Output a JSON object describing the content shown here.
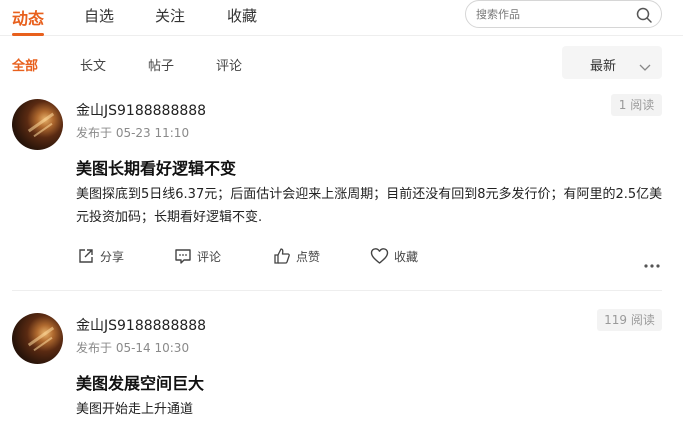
{
  "nav": {
    "tabs": [
      {
        "label": "动态",
        "active": true
      },
      {
        "label": "自选",
        "active": false
      },
      {
        "label": "关注",
        "active": false
      },
      {
        "label": "收藏",
        "active": false
      }
    ],
    "accent_color": "#e8601d"
  },
  "search": {
    "placeholder": "搜索作品",
    "icon": "search-icon"
  },
  "subnav": {
    "filters": [
      "全部",
      "长文",
      "帖子",
      "评论"
    ],
    "active": "全部"
  },
  "sort": {
    "label": "最新",
    "icon": "chevron-down-icon"
  },
  "posts": [
    {
      "username": "金山JS9188888888",
      "time": "发布于 05-23 11:10",
      "reads": "1 阅读",
      "title": "美图长期看好逻辑不变",
      "content": "美图探底到5日线6.37元；后面估计会迎来上涨周期；目前还没有回到8元多发行价；有阿里的2.5亿美元投资加码；长期看好逻辑不变.",
      "actions": {
        "share": "分享",
        "comment": "评论",
        "like": "点赞",
        "favorite": "收藏"
      }
    },
    {
      "username": "金山JS9188888888",
      "time": "发布于 05-14 10:30",
      "reads": "119 阅读",
      "title": "美图发展空间巨大",
      "content": "美图开始走上升通道"
    }
  ]
}
